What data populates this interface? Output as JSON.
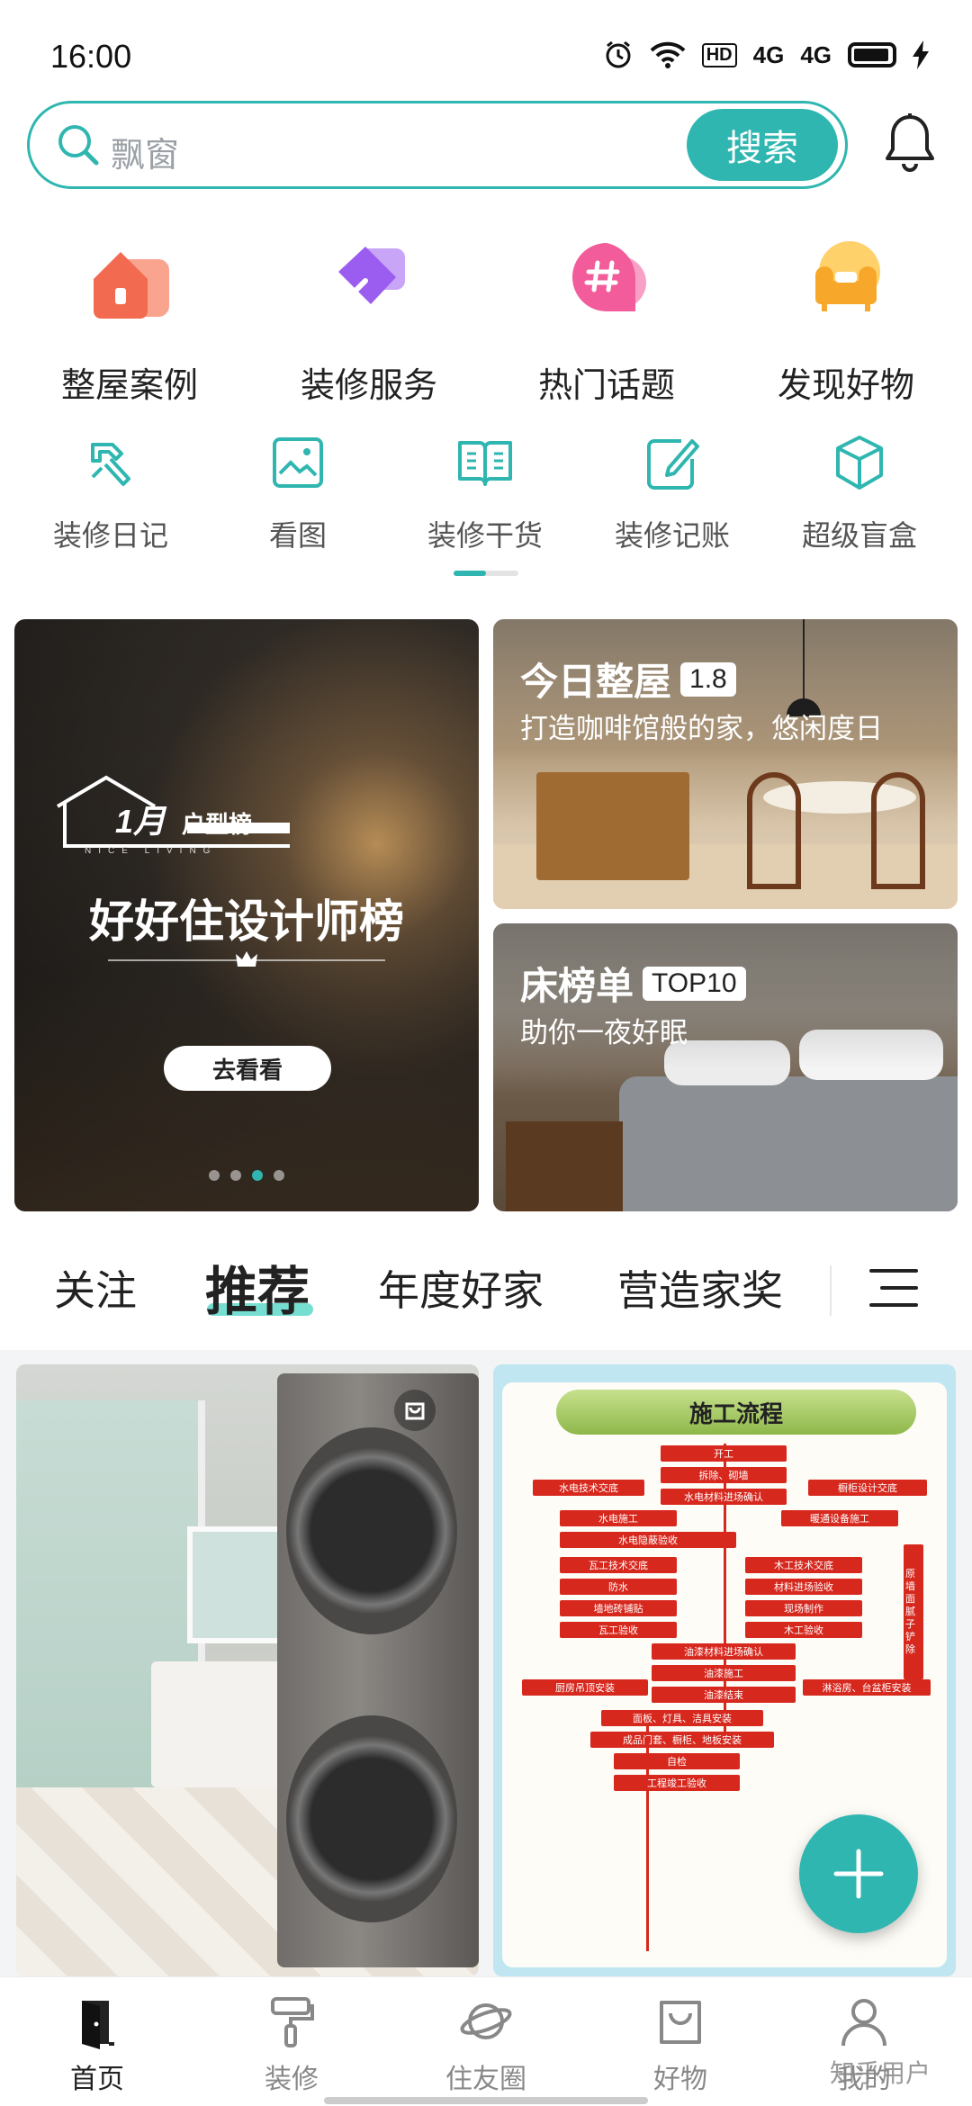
{
  "status_bar": {
    "time": "16:00",
    "icons": [
      "alarm-icon",
      "wifi-icon",
      "hd-icon",
      "signal-4g-icon",
      "signal-4g-icon",
      "battery-icon",
      "charging-icon"
    ],
    "hd_label": "HD",
    "net1_label": "4G",
    "net2_label": "4G"
  },
  "search": {
    "placeholder": "飘窗",
    "button_label": "搜索"
  },
  "main_nav": [
    {
      "label": "整屋案例",
      "icon": "house-icon",
      "color": "#f26a4f"
    },
    {
      "label": "装修服务",
      "icon": "brush-icon",
      "color": "#9b5cf0"
    },
    {
      "label": "热门话题",
      "icon": "hashtag-icon",
      "color": "#f25c9a"
    },
    {
      "label": "发现好物",
      "icon": "sofa-icon",
      "color": "#f7a82a"
    }
  ],
  "sub_nav": [
    {
      "label": "装修日记",
      "icon": "hammer-icon"
    },
    {
      "label": "看图",
      "icon": "picture-icon"
    },
    {
      "label": "装修干货",
      "icon": "book-icon"
    },
    {
      "label": "装修记账",
      "icon": "notepad-icon"
    },
    {
      "label": "超级盲盒",
      "icon": "cube-icon"
    }
  ],
  "banner_left": {
    "month_label": "1月",
    "tag_label": "户型榜",
    "logo_subtext": "NICE LIVING",
    "title": "好好住设计师榜",
    "button_label": "去看看",
    "dots_total": 4,
    "dots_active_index": 2
  },
  "banner_top_right": {
    "title": "今日整屋",
    "badge": "1.8",
    "subtitle": "打造咖啡馆般的家，悠闲度日"
  },
  "banner_bottom_right": {
    "title": "床榜单",
    "badge": "TOP10",
    "subtitle": "助你一夜好眠"
  },
  "tabs": [
    {
      "label": "关注",
      "active": false
    },
    {
      "label": "推荐",
      "active": true
    },
    {
      "label": "年度好家",
      "active": false
    },
    {
      "label": "营造家奖",
      "active": false
    }
  ],
  "feed_right": {
    "title": "施工流程",
    "steps": [
      "开工",
      "拆除、砌墙",
      "水电技术交底",
      "橱柜设计交底",
      "水电材料进场确认",
      "水电施工",
      "暖通设备施工",
      "水电隐蔽验收",
      "瓦工技术交底",
      "木工技术交底",
      "防水",
      "材料进场验收",
      "墙地砖铺贴",
      "现场制作",
      "瓦工验收",
      "木工验收",
      "油漆材料进场确认",
      "油漆施工",
      "厨房吊顶安装",
      "淋浴房、台盆柜安装",
      "油漆结束",
      "面板、灯具、洁具安装",
      "成品门套、橱柜、地板安装",
      "自检",
      "工程竣工验收",
      "原墙面腻子铲除"
    ]
  },
  "bottom_nav": [
    {
      "label": "首页",
      "icon": "home-door-icon",
      "active": true
    },
    {
      "label": "装修",
      "icon": "paint-roller-icon",
      "active": false
    },
    {
      "label": "住友圈",
      "icon": "planet-icon",
      "active": false
    },
    {
      "label": "好物",
      "icon": "shopping-bag-icon",
      "active": false
    },
    {
      "label": "我的",
      "icon": "user-icon",
      "active": false
    }
  ],
  "watermark": "知乎用户",
  "colors": {
    "accent": "#2fb6b0",
    "tab_highlight": "#54d6c6",
    "flow_red": "#d7281e"
  }
}
